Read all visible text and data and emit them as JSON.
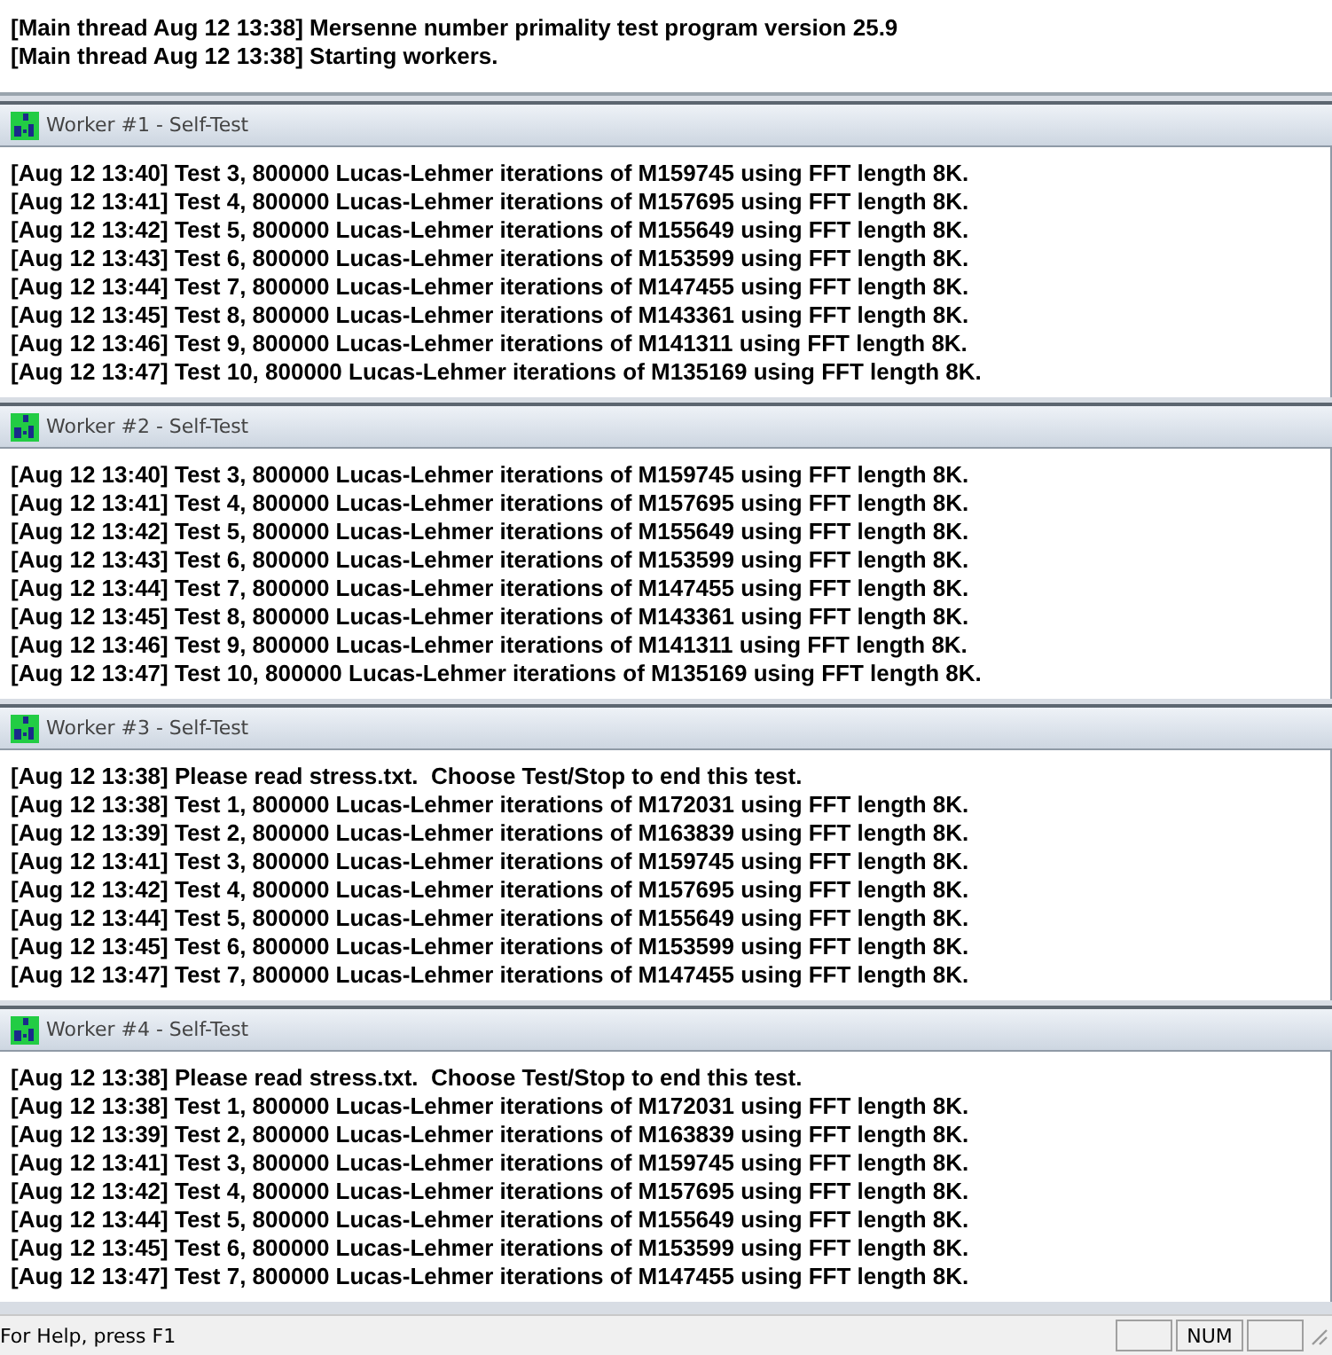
{
  "main_log": [
    "[Main thread Aug 12 13:38] Mersenne number primality test program version 25.9",
    "[Main thread Aug 12 13:38] Starting workers."
  ],
  "workers": [
    {
      "title": "Worker #1 - Self-Test",
      "lines": [
        "[Aug 12 13:40] Test 3, 800000 Lucas-Lehmer iterations of M159745 using FFT length 8K.",
        "[Aug 12 13:41] Test 4, 800000 Lucas-Lehmer iterations of M157695 using FFT length 8K.",
        "[Aug 12 13:42] Test 5, 800000 Lucas-Lehmer iterations of M155649 using FFT length 8K.",
        "[Aug 12 13:43] Test 6, 800000 Lucas-Lehmer iterations of M153599 using FFT length 8K.",
        "[Aug 12 13:44] Test 7, 800000 Lucas-Lehmer iterations of M147455 using FFT length 8K.",
        "[Aug 12 13:45] Test 8, 800000 Lucas-Lehmer iterations of M143361 using FFT length 8K.",
        "[Aug 12 13:46] Test 9, 800000 Lucas-Lehmer iterations of M141311 using FFT length 8K.",
        "[Aug 12 13:47] Test 10, 800000 Lucas-Lehmer iterations of M135169 using FFT length 8K."
      ]
    },
    {
      "title": "Worker #2 - Self-Test",
      "lines": [
        "[Aug 12 13:40] Test 3, 800000 Lucas-Lehmer iterations of M159745 using FFT length 8K.",
        "[Aug 12 13:41] Test 4, 800000 Lucas-Lehmer iterations of M157695 using FFT length 8K.",
        "[Aug 12 13:42] Test 5, 800000 Lucas-Lehmer iterations of M155649 using FFT length 8K.",
        "[Aug 12 13:43] Test 6, 800000 Lucas-Lehmer iterations of M153599 using FFT length 8K.",
        "[Aug 12 13:44] Test 7, 800000 Lucas-Lehmer iterations of M147455 using FFT length 8K.",
        "[Aug 12 13:45] Test 8, 800000 Lucas-Lehmer iterations of M143361 using FFT length 8K.",
        "[Aug 12 13:46] Test 9, 800000 Lucas-Lehmer iterations of M141311 using FFT length 8K.",
        "[Aug 12 13:47] Test 10, 800000 Lucas-Lehmer iterations of M135169 using FFT length 8K."
      ]
    },
    {
      "title": "Worker #3 - Self-Test",
      "lines": [
        "[Aug 12 13:38] Please read stress.txt.  Choose Test/Stop to end this test.",
        "[Aug 12 13:38] Test 1, 800000 Lucas-Lehmer iterations of M172031 using FFT length 8K.",
        "[Aug 12 13:39] Test 2, 800000 Lucas-Lehmer iterations of M163839 using FFT length 8K.",
        "[Aug 12 13:41] Test 3, 800000 Lucas-Lehmer iterations of M159745 using FFT length 8K.",
        "[Aug 12 13:42] Test 4, 800000 Lucas-Lehmer iterations of M157695 using FFT length 8K.",
        "[Aug 12 13:44] Test 5, 800000 Lucas-Lehmer iterations of M155649 using FFT length 8K.",
        "[Aug 12 13:45] Test 6, 800000 Lucas-Lehmer iterations of M153599 using FFT length 8K.",
        "[Aug 12 13:47] Test 7, 800000 Lucas-Lehmer iterations of M147455 using FFT length 8K."
      ]
    },
    {
      "title": "Worker #4 - Self-Test",
      "lines": [
        "[Aug 12 13:38] Please read stress.txt.  Choose Test/Stop to end this test.",
        "[Aug 12 13:38] Test 1, 800000 Lucas-Lehmer iterations of M172031 using FFT length 8K.",
        "[Aug 12 13:39] Test 2, 800000 Lucas-Lehmer iterations of M163839 using FFT length 8K.",
        "[Aug 12 13:41] Test 3, 800000 Lucas-Lehmer iterations of M159745 using FFT length 8K.",
        "[Aug 12 13:42] Test 4, 800000 Lucas-Lehmer iterations of M157695 using FFT length 8K.",
        "[Aug 12 13:44] Test 5, 800000 Lucas-Lehmer iterations of M155649 using FFT length 8K.",
        "[Aug 12 13:45] Test 6, 800000 Lucas-Lehmer iterations of M153599 using FFT length 8K.",
        "[Aug 12 13:47] Test 7, 800000 Lucas-Lehmer iterations of M147455 using FFT length 8K."
      ]
    }
  ],
  "status_bar": {
    "help": "For Help, press F1",
    "indicators": [
      {
        "kind": "blank"
      },
      {
        "kind": "text",
        "text": "NUM"
      },
      {
        "kind": "blank"
      }
    ]
  }
}
